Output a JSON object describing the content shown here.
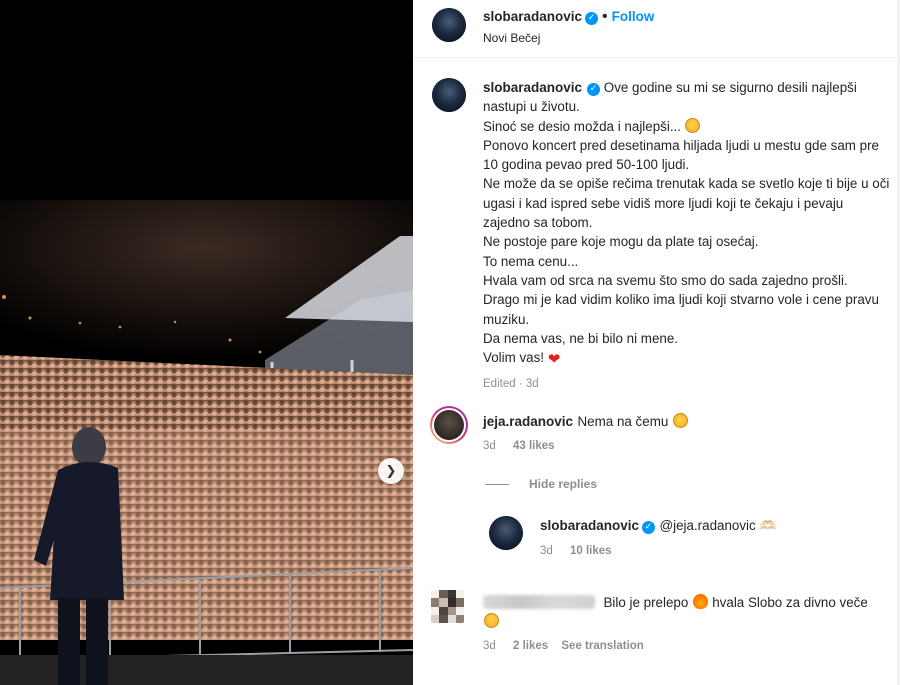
{
  "post": {
    "username": "slobaradanovic",
    "follow_label": "Follow",
    "location": "Novi Bečej",
    "verified_icon": "verified-badge-icon"
  },
  "caption": {
    "username": "slobaradanovic",
    "lines": [
      "Ove godine su mi se sigurno desili najlepši nastupi u životu.",
      "Sinoć se desio možda i najlepši...",
      "Ponovo koncert pred desetinama hiljada ljudi u mestu gde sam pre 10 godina pevao pred 50-100 ljudi.",
      "Ne može da se opiše rečima trenutak kada se svetlo koje ti bije u oči ugasi i kad ispred sebe vidiš more ljudi koji te čekaju i pevaju zajedno sa tobom.",
      "Ne postoje pare koje mogu da plate taj osećaj.",
      "To nema cenu...",
      "Hvala vam od srca na svemu što smo do sada zajedno prošli.",
      "Drago mi je kad vidim koliko ima ljudi koji stvarno vole i cene pravu muziku.",
      "Da nema vas, ne bi bilo ni mene.",
      "Volim vas!"
    ],
    "meta": "Edited · 3d"
  },
  "comments": [
    {
      "username": "jeja.radanovic",
      "text": "Nema na čemu",
      "age": "3d",
      "likes": "43 likes",
      "hide_replies_label": "Hide replies",
      "replies": [
        {
          "username": "slobaradanovic",
          "text": "@jeja.radanovic 🫶🏻",
          "age": "3d",
          "likes": "10 likes"
        }
      ]
    },
    {
      "username_hidden": true,
      "text": "Bilo je prelepo",
      "text_after": "hvala Slobo za divno veče",
      "age": "3d",
      "likes": "2 likes",
      "see_translation_label": "See translation"
    }
  ],
  "photo": {
    "carousel_next_icon": "chevron-right-icon"
  },
  "colors": {
    "accent": "#0095f6",
    "text": "#262626",
    "muted": "#8e8e8e",
    "heart": "#e02424"
  }
}
